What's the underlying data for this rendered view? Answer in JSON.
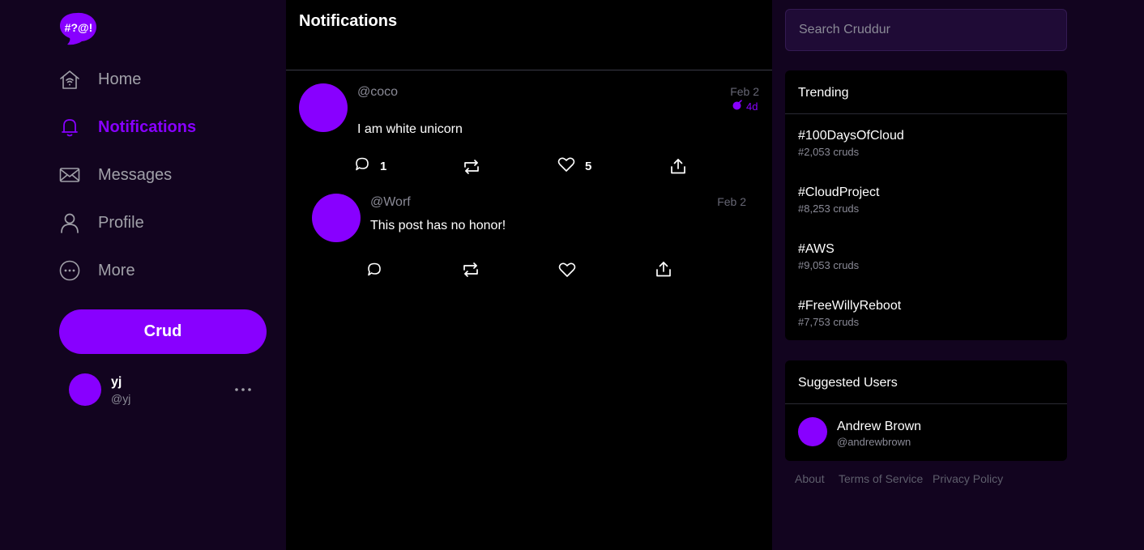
{
  "app": {
    "logo_text": "#?@!",
    "brand_color": "#8800ff"
  },
  "nav": {
    "items": [
      {
        "label": "Home",
        "icon": "home-icon"
      },
      {
        "label": "Notifications",
        "icon": "bell-icon",
        "active": true
      },
      {
        "label": "Messages",
        "icon": "envelope-icon"
      },
      {
        "label": "Profile",
        "icon": "user-icon"
      },
      {
        "label": "More",
        "icon": "more-circle-icon"
      }
    ],
    "crud_button": "Crud"
  },
  "current_user": {
    "name": "yj",
    "handle": "@yj"
  },
  "feed": {
    "title": "Notifications",
    "activities": [
      {
        "handle": "@coco",
        "date": "Feb 2",
        "expires": "4d",
        "message": "I am white unicorn",
        "replies_count": "1",
        "likes_count": "5"
      },
      {
        "handle": "@Worf",
        "date": "Feb 2",
        "message": "This post has no honor!"
      }
    ]
  },
  "search": {
    "placeholder": "Search Cruddur"
  },
  "trending": {
    "title": "Trending",
    "items": [
      {
        "tag": "#100DaysOfCloud",
        "count": "#2,053 cruds"
      },
      {
        "tag": "#CloudProject",
        "count": "#8,253 cruds"
      },
      {
        "tag": "#AWS",
        "count": "#9,053 cruds"
      },
      {
        "tag": "#FreeWillyReboot",
        "count": "#7,753 cruds"
      }
    ]
  },
  "suggested": {
    "title": "Suggested Users",
    "users": [
      {
        "name": "Andrew Brown",
        "handle": "@andrewbrown"
      }
    ]
  },
  "footer": {
    "links": [
      "About",
      "Terms of Service",
      "Privacy Policy"
    ]
  }
}
